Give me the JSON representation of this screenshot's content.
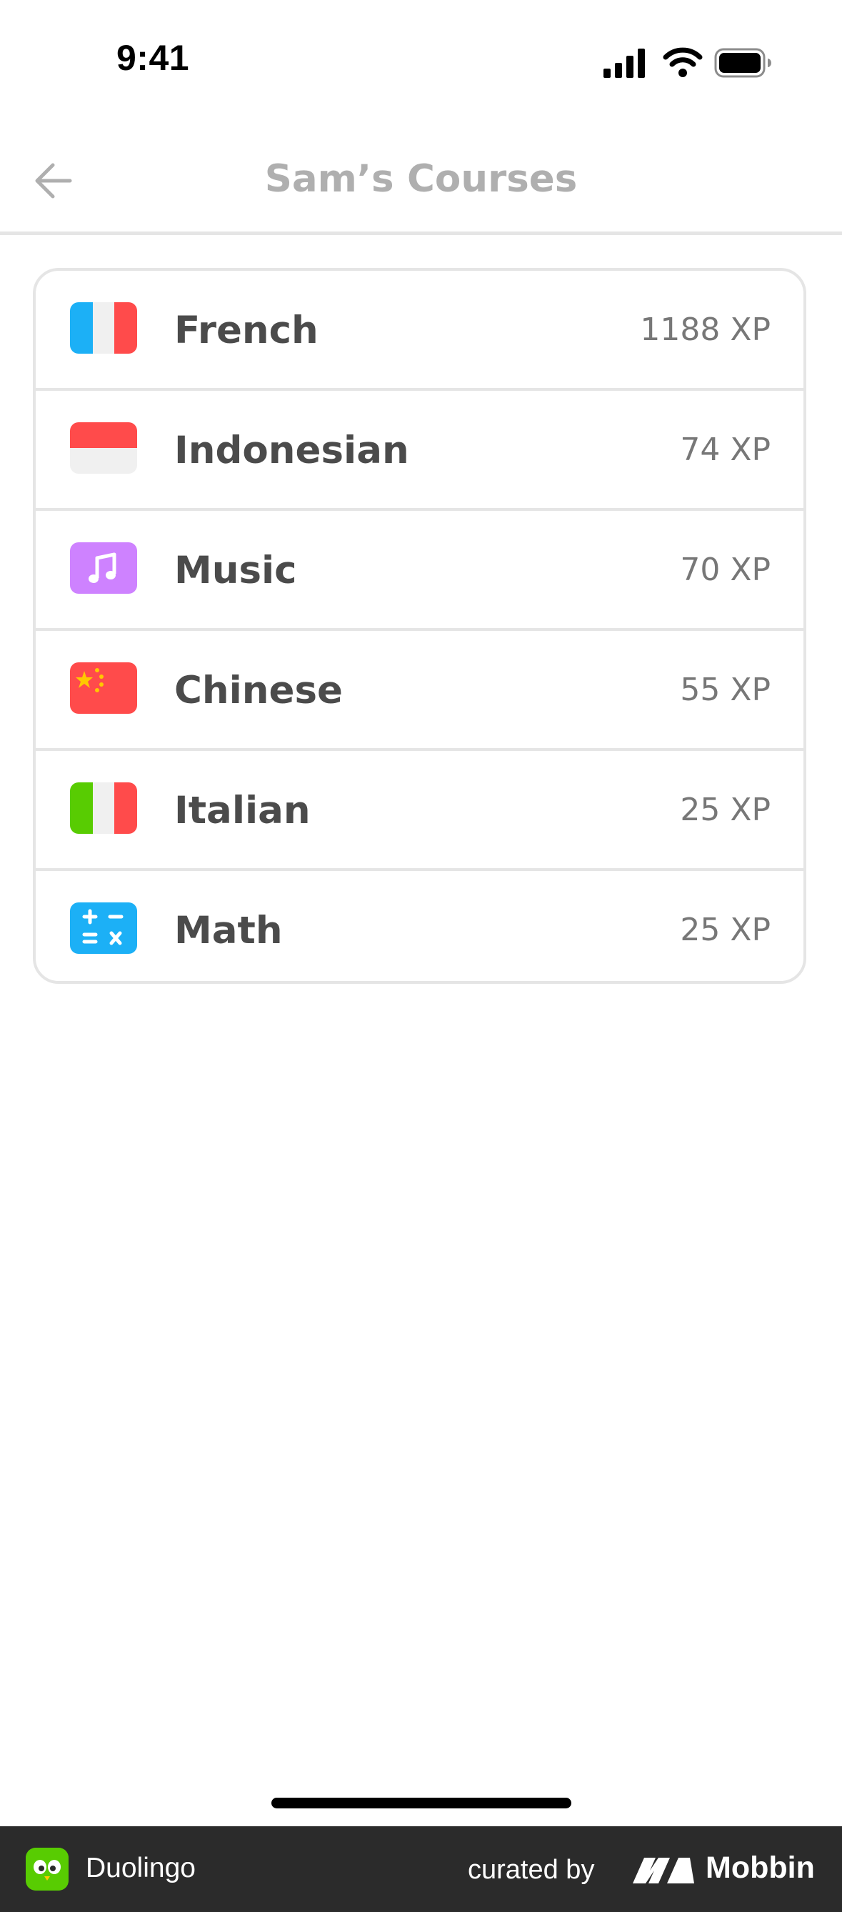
{
  "status_bar": {
    "time": "9:41",
    "icons": [
      "signal-icon",
      "wifi-icon",
      "battery-icon"
    ]
  },
  "header": {
    "back_icon": "arrow-left-icon",
    "title": "Sam’s Courses"
  },
  "courses": [
    {
      "name": "French",
      "xp": "1188 XP",
      "icon": "france-flag-icon"
    },
    {
      "name": "Indonesian",
      "xp": "74 XP",
      "icon": "indonesia-flag-icon"
    },
    {
      "name": "Music",
      "xp": "70 XP",
      "icon": "music-note-icon"
    },
    {
      "name": "Chinese",
      "xp": "55 XP",
      "icon": "china-flag-icon"
    },
    {
      "name": "Italian",
      "xp": "25 XP",
      "icon": "italy-flag-icon"
    },
    {
      "name": "Math",
      "xp": "25 XP",
      "icon": "calculator-icon"
    }
  ],
  "footer": {
    "app_name": "Duolingo",
    "curated_by": "curated by",
    "brand": "Mobbin"
  },
  "colors": {
    "title_gray": "#afafaf",
    "divider": "#e5e5e5",
    "course_text": "#4b4b4b",
    "xp_text": "#777777",
    "france_blue": "#1cb0f6",
    "flag_red": "#ff4b4b",
    "flag_white": "#f0f0f0",
    "music_purple": "#ce82ff",
    "italy_green": "#58cc02",
    "star_yellow": "#ffc800",
    "footer_bg": "#2b2b2b"
  }
}
